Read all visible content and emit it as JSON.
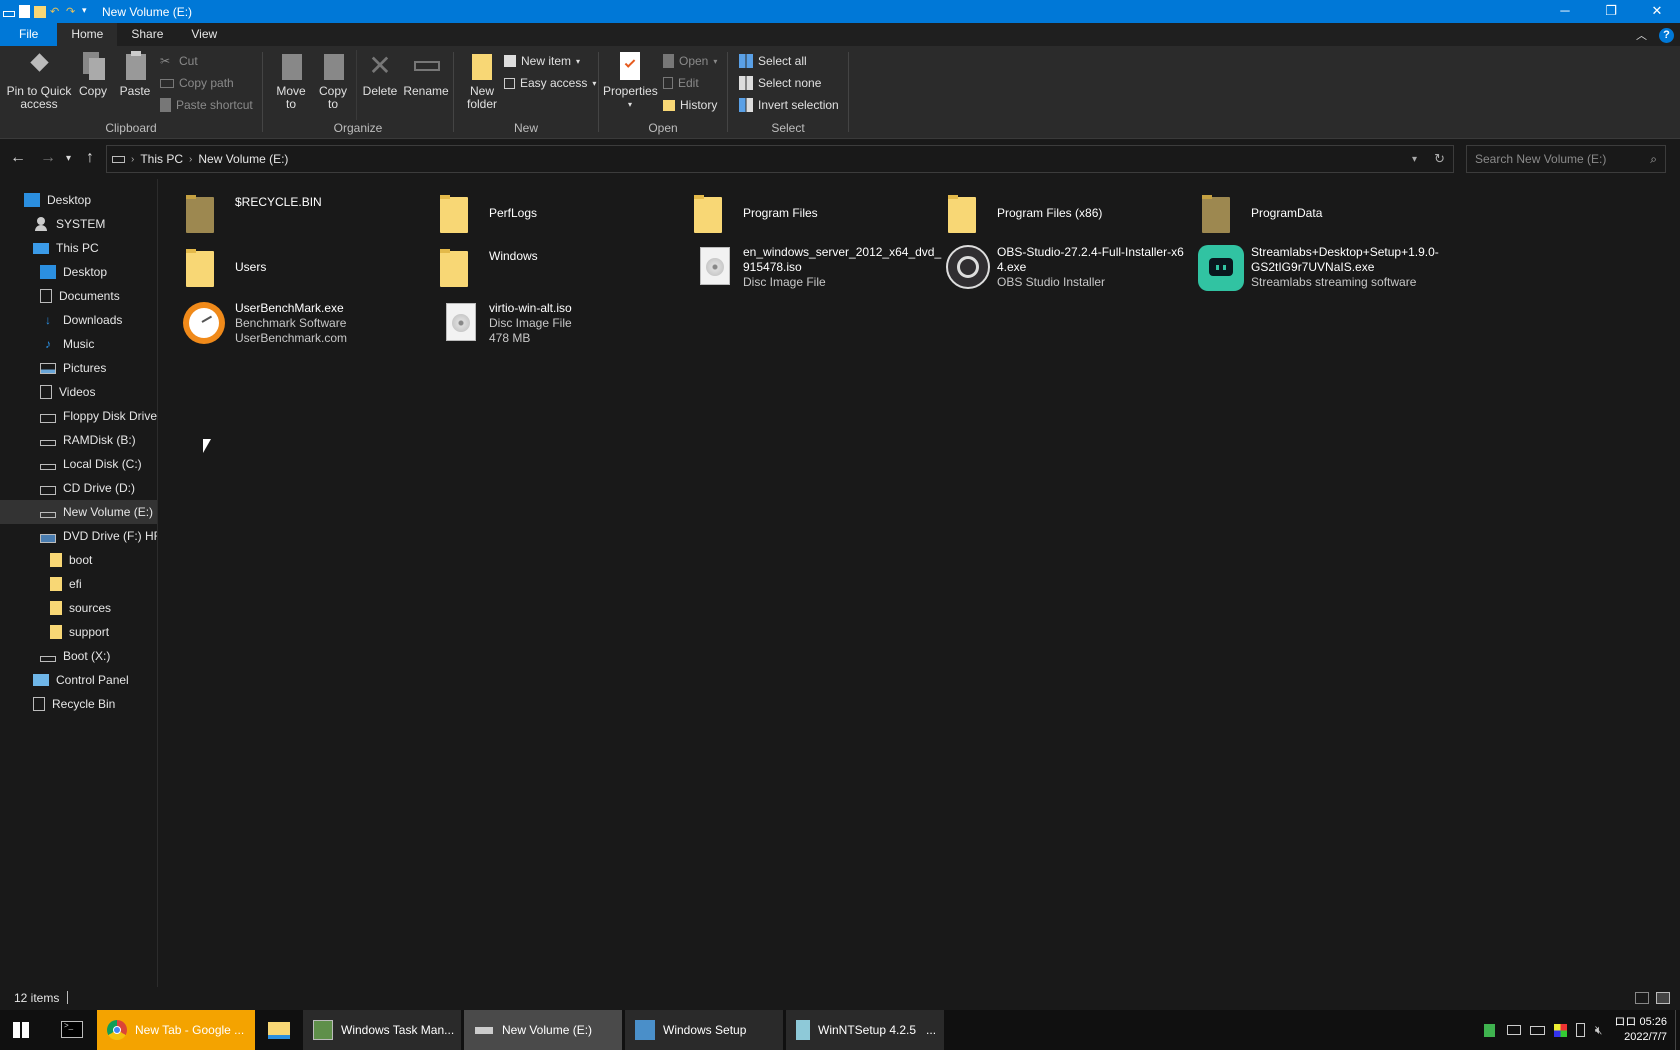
{
  "window": {
    "title": "New Volume (E:)"
  },
  "ribbon_tabs": [
    "File",
    "Home",
    "Share",
    "View"
  ],
  "ribbon": {
    "clipboard": {
      "label": "Clipboard",
      "pin": "Pin to Quick\naccess",
      "copy": "Copy",
      "paste": "Paste",
      "cut": "Cut",
      "copy_path": "Copy path",
      "paste_shortcut": "Paste shortcut"
    },
    "organize": {
      "label": "Organize",
      "move_to": "Move\nto",
      "copy_to": "Copy\nto",
      "delete": "Delete",
      "rename": "Rename"
    },
    "new": {
      "label": "New",
      "new_folder": "New\nfolder",
      "new_item": "New item",
      "easy_access": "Easy access"
    },
    "open": {
      "label": "Open",
      "properties": "Properties",
      "open": "Open",
      "edit": "Edit",
      "history": "History"
    },
    "select": {
      "label": "Select",
      "select_all": "Select all",
      "select_none": "Select none",
      "invert": "Invert selection"
    }
  },
  "address": {
    "crumbs": [
      "This PC",
      "New Volume (E:)"
    ],
    "search_placeholder": "Search New Volume (E:)"
  },
  "nav": [
    {
      "label": "Desktop",
      "icon": "desktop-icon"
    },
    {
      "label": "SYSTEM",
      "icon": "user-icon"
    },
    {
      "label": "This PC",
      "icon": "computer-icon"
    },
    {
      "label": "Desktop",
      "icon": "desktop-icon"
    },
    {
      "label": "Documents",
      "icon": "documents-icon"
    },
    {
      "label": "Downloads",
      "icon": "downloads-icon"
    },
    {
      "label": "Music",
      "icon": "music-icon"
    },
    {
      "label": "Pictures",
      "icon": "pictures-icon"
    },
    {
      "label": "Videos",
      "icon": "videos-icon"
    },
    {
      "label": "Floppy Disk Drive",
      "icon": "floppy-icon"
    },
    {
      "label": "RAMDisk (B:)",
      "icon": "drive-icon"
    },
    {
      "label": "Local Disk (C:)",
      "icon": "drive-icon"
    },
    {
      "label": "CD Drive (D:)",
      "icon": "cd-drive-icon"
    },
    {
      "label": "New Volume (E:)",
      "icon": "drive-icon"
    },
    {
      "label": "DVD Drive (F:) HRN",
      "icon": "dvd-drive-icon"
    },
    {
      "label": "boot",
      "icon": "folder-icon"
    },
    {
      "label": "efi",
      "icon": "folder-icon"
    },
    {
      "label": "sources",
      "icon": "folder-icon"
    },
    {
      "label": "support",
      "icon": "folder-icon"
    },
    {
      "label": "Boot (X:)",
      "icon": "drive-icon"
    },
    {
      "label": "Control Panel",
      "icon": "control-panel-icon"
    },
    {
      "label": "Recycle Bin",
      "icon": "recycle-bin-icon"
    }
  ],
  "files": [
    {
      "name": "$RECYCLE.BIN",
      "sub1": "",
      "sub2": "",
      "icon": "folder-icon-dim"
    },
    {
      "name": "PerfLogs",
      "sub1": "",
      "sub2": "",
      "icon": "folder-icon"
    },
    {
      "name": "Program Files",
      "sub1": "",
      "sub2": "",
      "icon": "folder-icon"
    },
    {
      "name": "Program Files (x86)",
      "sub1": "",
      "sub2": "",
      "icon": "folder-icon"
    },
    {
      "name": "ProgramData",
      "sub1": "",
      "sub2": "",
      "icon": "folder-icon-dim"
    },
    {
      "name": "Users",
      "sub1": "",
      "sub2": "",
      "icon": "folder-icon"
    },
    {
      "name": "Windows",
      "sub1": "",
      "sub2": "",
      "icon": "folder-icon"
    },
    {
      "name": "en_windows_server_2012_x64_dvd_\n915478.iso",
      "sub1": "Disc Image File",
      "sub2": "",
      "icon": "disc-image-icon"
    },
    {
      "name": "OBS-Studio-27.2.4-Full-Installer-x6\n4.exe",
      "sub1": "OBS Studio Installer",
      "sub2": "",
      "icon": "obs-icon"
    },
    {
      "name": "Streamlabs+Desktop+Setup+1.9.0-\nGS2tIG9r7UVNaIS.exe",
      "sub1": "Streamlabs streaming software",
      "sub2": "",
      "icon": "streamlabs-icon"
    },
    {
      "name": "UserBenchMark.exe",
      "sub1": "Benchmark Software",
      "sub2": "UserBenchmark.com",
      "icon": "userbenchmark-icon"
    },
    {
      "name": "virtio-win-alt.iso",
      "sub1": "Disc Image File",
      "sub2": "478 MB",
      "icon": "disc-image-icon"
    }
  ],
  "status": {
    "count": "12 items"
  },
  "taskbar": {
    "items": [
      {
        "label": "New Tab - Google ...",
        "icon": "chrome-icon"
      },
      {
        "label": "Windows Task Man...",
        "icon": "task-manager-icon"
      },
      {
        "label": "New Volume (E:)",
        "icon": "drive-icon"
      },
      {
        "label": "Windows Setup",
        "icon": "setup-icon"
      },
      {
        "label": "WinNTSetup 4.2.5",
        "icon": "winntsetup-icon"
      }
    ],
    "overflow": "...",
    "clock_time": "05:26",
    "clock_date": "2022/7/7",
    "clock_prefix": "ロロ"
  },
  "colors": {
    "accent": "#0078d7",
    "taskbar_chrome": "#f4a300",
    "bg": "#191919"
  }
}
